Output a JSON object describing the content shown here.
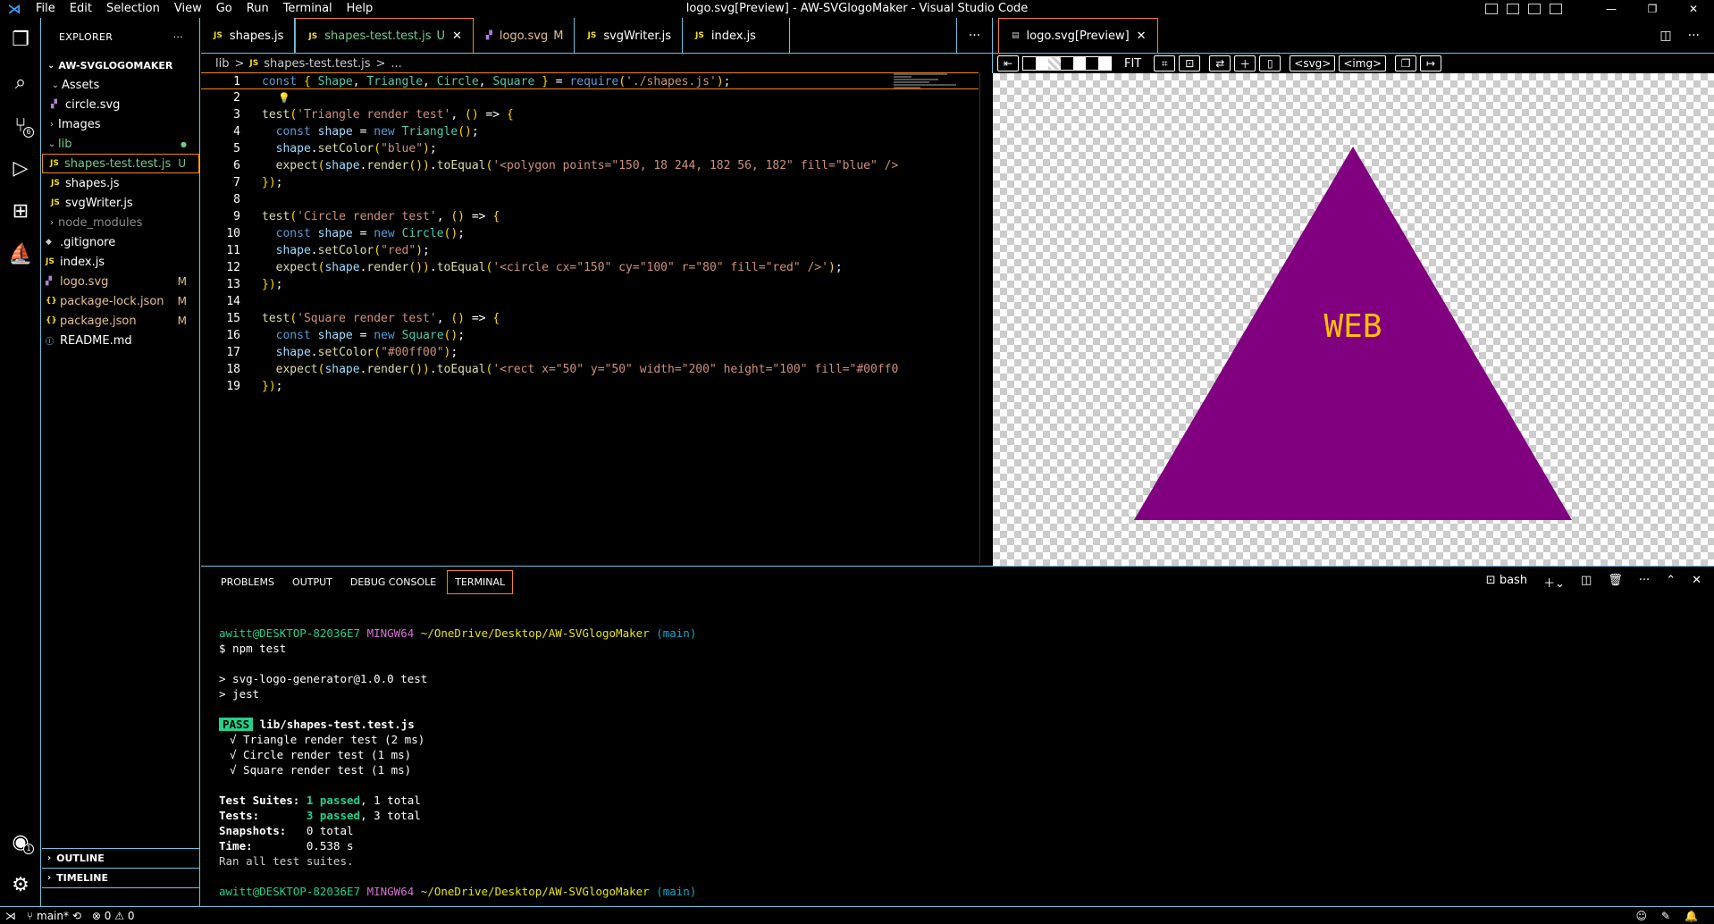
{
  "window": {
    "title": "logo.svg[Preview] - AW-SVGlogoMaker - Visual Studio Code",
    "menu": [
      "File",
      "Edit",
      "Selection",
      "View",
      "Go",
      "Run",
      "Terminal",
      "Help"
    ]
  },
  "activity": {
    "source_control_badge": "6",
    "accounts_badge": "1"
  },
  "explorer": {
    "header": "EXPLORER",
    "more": "···",
    "project": "AW-SVGLOGOMAKER",
    "items": [
      {
        "label": "Assets",
        "type": "folder",
        "status": ""
      },
      {
        "label": "circle.svg",
        "type": "svg",
        "status": ""
      },
      {
        "label": "Images",
        "type": "folder",
        "status": ""
      },
      {
        "label": "lib",
        "type": "folder",
        "status": "●"
      },
      {
        "label": "shapes-test.test.js",
        "type": "js",
        "status": "U"
      },
      {
        "label": "shapes.js",
        "type": "js",
        "status": ""
      },
      {
        "label": "svgWriter.js",
        "type": "js",
        "status": ""
      },
      {
        "label": "node_modules",
        "type": "folder",
        "status": ""
      },
      {
        "label": ".gitignore",
        "type": "git",
        "status": ""
      },
      {
        "label": "index.js",
        "type": "js",
        "status": ""
      },
      {
        "label": "logo.svg",
        "type": "svg",
        "status": "M"
      },
      {
        "label": "package-lock.json",
        "type": "json",
        "status": "M"
      },
      {
        "label": "package.json",
        "type": "json",
        "status": "M"
      },
      {
        "label": "README.md",
        "type": "info",
        "status": ""
      }
    ],
    "outline": "OUTLINE",
    "timeline": "TIMELINE"
  },
  "tabs": [
    {
      "label": "shapes.js",
      "mark": "",
      "icon": "JS"
    },
    {
      "label": "shapes-test.test.js",
      "mark": "U",
      "icon": "JS"
    },
    {
      "label": "logo.svg",
      "mark": "M",
      "icon": "svg"
    },
    {
      "label": "svgWriter.js",
      "mark": "",
      "icon": "JS"
    },
    {
      "label": "index.js",
      "mark": "",
      "icon": "JS"
    }
  ],
  "tabs_more": "···",
  "breadcrumb": [
    "lib",
    ">",
    "JS",
    "shapes-test.test.js",
    ">",
    "..."
  ],
  "code": {
    "lines": [
      "const { Shape, Triangle, Circle, Square } = require('./shapes.js');",
      "",
      "test('Triangle render test', () => {",
      "  const shape = new Triangle();",
      "  shape.setColor(\"blue\");",
      "  expect(shape.render()).toEqual('<polygon points=\"150, 18 244, 182 56, 182\" fill=\"blue\" />",
      "});",
      "",
      "test('Circle render test', () => {",
      "  const shape = new Circle();",
      "  shape.setColor(\"red\");",
      "  expect(shape.render()).toEqual('<circle cx=\"150\" cy=\"100\" r=\"80\" fill=\"red\" />');",
      "});",
      "",
      "test('Square render test', () => {",
      "  const shape = new Square();",
      "  shape.setColor(\"#00ff00\");",
      "  expect(shape.render()).toEqual('<rect x=\"50\" y=\"50\" width=\"200\" height=\"100\" fill=\"#00ff0",
      "});"
    ]
  },
  "preview": {
    "tab_label": "logo.svg[Preview]",
    "toolbar": {
      "fit": "FIT",
      "svg_btn": "<svg>",
      "img_btn": "<img>"
    },
    "logo": {
      "shape_color": "#800080",
      "text": "WEB",
      "text_color": "#FFBF00"
    }
  },
  "panel": {
    "tabs": [
      "PROBLEMS",
      "OUTPUT",
      "DEBUG CONSOLE",
      "TERMINAL"
    ],
    "active_tab": "TERMINAL",
    "shell": "bash",
    "terminal": {
      "user": "awitt@DESKTOP-82036E7",
      "env": "MINGW64",
      "path": "~/OneDrive/Desktop/AW-SVGlogoMaker",
      "branch": "(main)",
      "command": "$ npm test",
      "out1": "> svg-logo-generator@1.0.0 test",
      "out2": "> jest",
      "pass": "PASS",
      "file": "lib/shapes-test.test.js",
      "results": [
        "√ Triangle render test (2 ms)",
        "√ Circle render test (1 ms)",
        "√ Square render test (1 ms)"
      ],
      "suites_label": "Test Suites:",
      "suites_passed": "1 passed",
      "suites_total": ", 1 total",
      "tests_label": "Tests:",
      "tests_passed": "3 passed",
      "tests_total": ", 3 total",
      "snap_label": "Snapshots:",
      "snap_val": "0 total",
      "time_label": "Time:",
      "time_val": "0.538 s",
      "ran": "Ran all test suites."
    }
  },
  "statusbar": {
    "branch": "main*",
    "errors": "0",
    "warnings": "0"
  }
}
